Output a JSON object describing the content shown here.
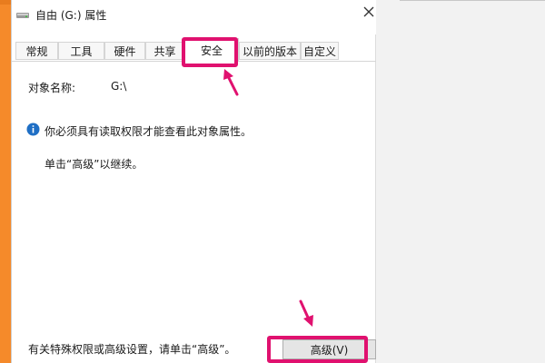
{
  "window": {
    "title": "自由 (G:) 属性",
    "icon": "drive-icon",
    "close_icon": "close-icon"
  },
  "tabs": [
    {
      "label": "常规"
    },
    {
      "label": "工具"
    },
    {
      "label": "硬件"
    },
    {
      "label": "共享"
    },
    {
      "label": "安全",
      "active": true
    },
    {
      "label": "以前的版本"
    },
    {
      "label": "自定义"
    }
  ],
  "security": {
    "object_name_label": "对象名称:",
    "object_name_value": "G:\\",
    "info_message": "你必须具有读取权限才能查看此对象属性。",
    "continue_message": "单击“高级”以继续。",
    "special_permissions_message": "有关特殊权限或高级设置，请单击“高级”。",
    "advanced_button_label": "高级(V)"
  },
  "colors": {
    "highlight": "#e0116f",
    "accent_orange": "#f58a2a",
    "info_blue": "#1f6fc5"
  }
}
